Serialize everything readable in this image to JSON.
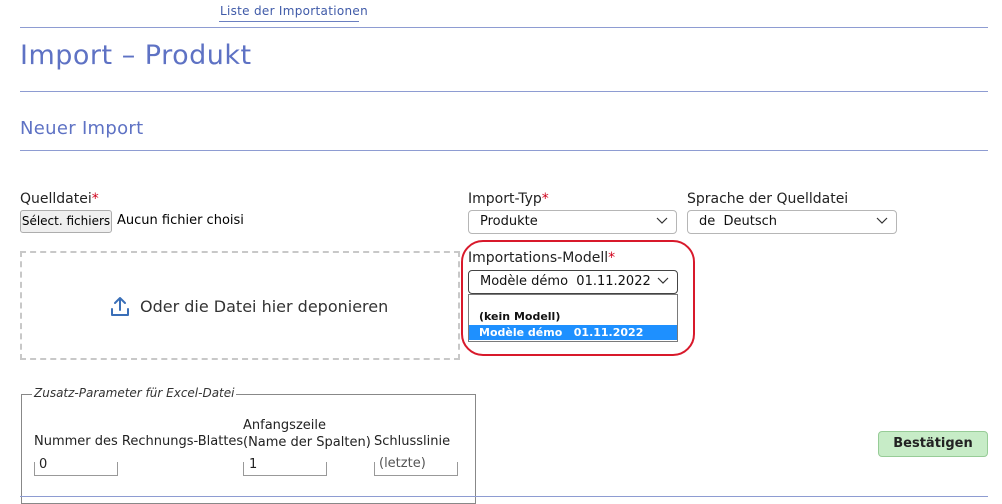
{
  "nav": {
    "tab_label": "Liste der Importationen"
  },
  "page": {
    "title": "Import – Produkt",
    "section_title": "Neuer Import"
  },
  "source_file": {
    "label": "Quelldatei",
    "required_mark": "*",
    "button_label": "Sélect. fichiers",
    "status_text": "Aucun fichier choisi"
  },
  "dropzone": {
    "text": "Oder die Datei hier deponieren",
    "icon": "upload-icon"
  },
  "import_type": {
    "label": "Import-Typ",
    "required_mark": "*",
    "value": "Produkte"
  },
  "source_language": {
    "label": "Sprache der Quelldatei",
    "code": "de",
    "value": "Deutsch"
  },
  "import_model": {
    "label": "Importations-Modell",
    "required_mark": "*",
    "selected_name": "Modèle démo",
    "selected_date": "01.11.2022",
    "options": [
      {
        "label": "(kein Modell)",
        "date": "",
        "selected": false
      },
      {
        "label": "Modèle démo",
        "date": "01.11.2022",
        "selected": true
      }
    ]
  },
  "excel_params": {
    "legend": "Zusatz-Parameter für Excel-Datei",
    "sheet_number": {
      "label": "Nummer des Rechnungs-Blattes",
      "value": "0"
    },
    "start_row": {
      "label_line1": "Anfangszeile",
      "label_line2": "(Name der Spalten)",
      "value": "1"
    },
    "end_row": {
      "label": "Schlusslinie",
      "placeholder": "(letzte)"
    }
  },
  "confirm_button": {
    "label": "Bestätigen"
  },
  "colors": {
    "accent": "#5e72c4",
    "required": "#d0021b",
    "highlight_ring": "#d8192b",
    "selected_option": "#1e90ff",
    "confirm_bg": "#c7ecc7"
  }
}
